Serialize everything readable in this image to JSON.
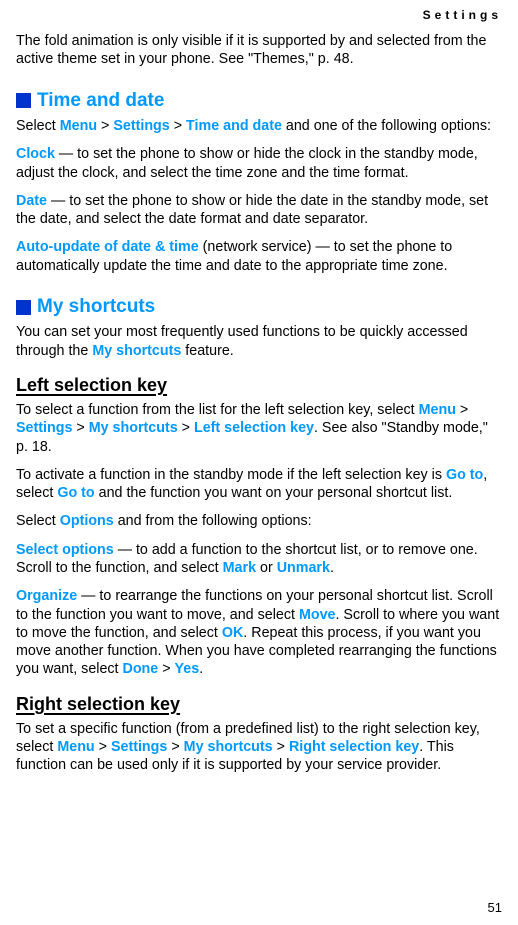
{
  "header": {
    "label": "Settings"
  },
  "intro": {
    "para1_pre": "The fold animation is only visible if it is supported by and selected from the active theme set in your phone. See \"Themes,\" p. 48."
  },
  "time_date": {
    "title": "Time and date",
    "select_pre": "Select ",
    "menu": "Menu",
    "settings": "Settings",
    "timedate": "Time and date",
    "select_post": " and one of the following options:",
    "clock": "Clock",
    "clock_desc": " — to set the phone to show or hide the clock in the standby mode, adjust the clock, and select the time zone and the time format.",
    "date": "Date",
    "date_desc": " — to set the phone to show or hide the date in the standby mode, set the date, and select the date format and date separator.",
    "auto": "Auto-update of date & time",
    "auto_desc": " (network service) — to set the phone to automatically update the time and date to the appropriate time zone."
  },
  "shortcuts": {
    "title": "My shortcuts",
    "intro_pre": "You can set your most frequently used functions to be quickly accessed through the ",
    "intro_bold": "My shortcuts",
    "intro_post": " feature."
  },
  "left_key": {
    "title": "Left selection key",
    "p1_pre": "To select a function from the list for the left selection key, select ",
    "menu": "Menu",
    "settings": "Settings",
    "myshortcuts": "My shortcuts",
    "leftsel": "Left selection key",
    "p1_post": ". See also \"Standby mode,\" p. 18.",
    "p2_pre": "To activate a function in the standby mode if the left selection key is ",
    "goto1": "Go to",
    "p2_mid": ", select ",
    "goto2": "Go to",
    "p2_post": " and the function you want on your personal shortcut list.",
    "p3_pre": "Select ",
    "options": "Options",
    "p3_post": " and from the following options:",
    "selopt": "Select options",
    "selopt_desc_pre": " — to add a function to the shortcut list, or to remove one. Scroll to the function, and select ",
    "mark": "Mark",
    "or": " or ",
    "unmark": "Unmark",
    "period": ".",
    "organize": "Organize",
    "org_desc_pre": " — to rearrange the functions on your personal shortcut list. Scroll to the function you want to move, and select ",
    "move": "Move",
    "org_desc_mid": ". Scroll to where you want to move the function, and select ",
    "ok": "OK",
    "org_desc_mid2": ". Repeat this process, if you want you move another function. When you have completed rearranging the functions you want, select ",
    "done": "Done",
    "yes": "Yes"
  },
  "right_key": {
    "title": "Right selection key",
    "p1_pre": "To set a specific function (from a predefined list) to the right selection key, select ",
    "menu": "Menu",
    "settings": "Settings",
    "myshortcuts": "My shortcuts",
    "rightsel": "Right selection key",
    "p1_post": ". This function can be used only if it is supported by your service provider."
  },
  "footer": {
    "page": "51"
  },
  "sep": " > "
}
